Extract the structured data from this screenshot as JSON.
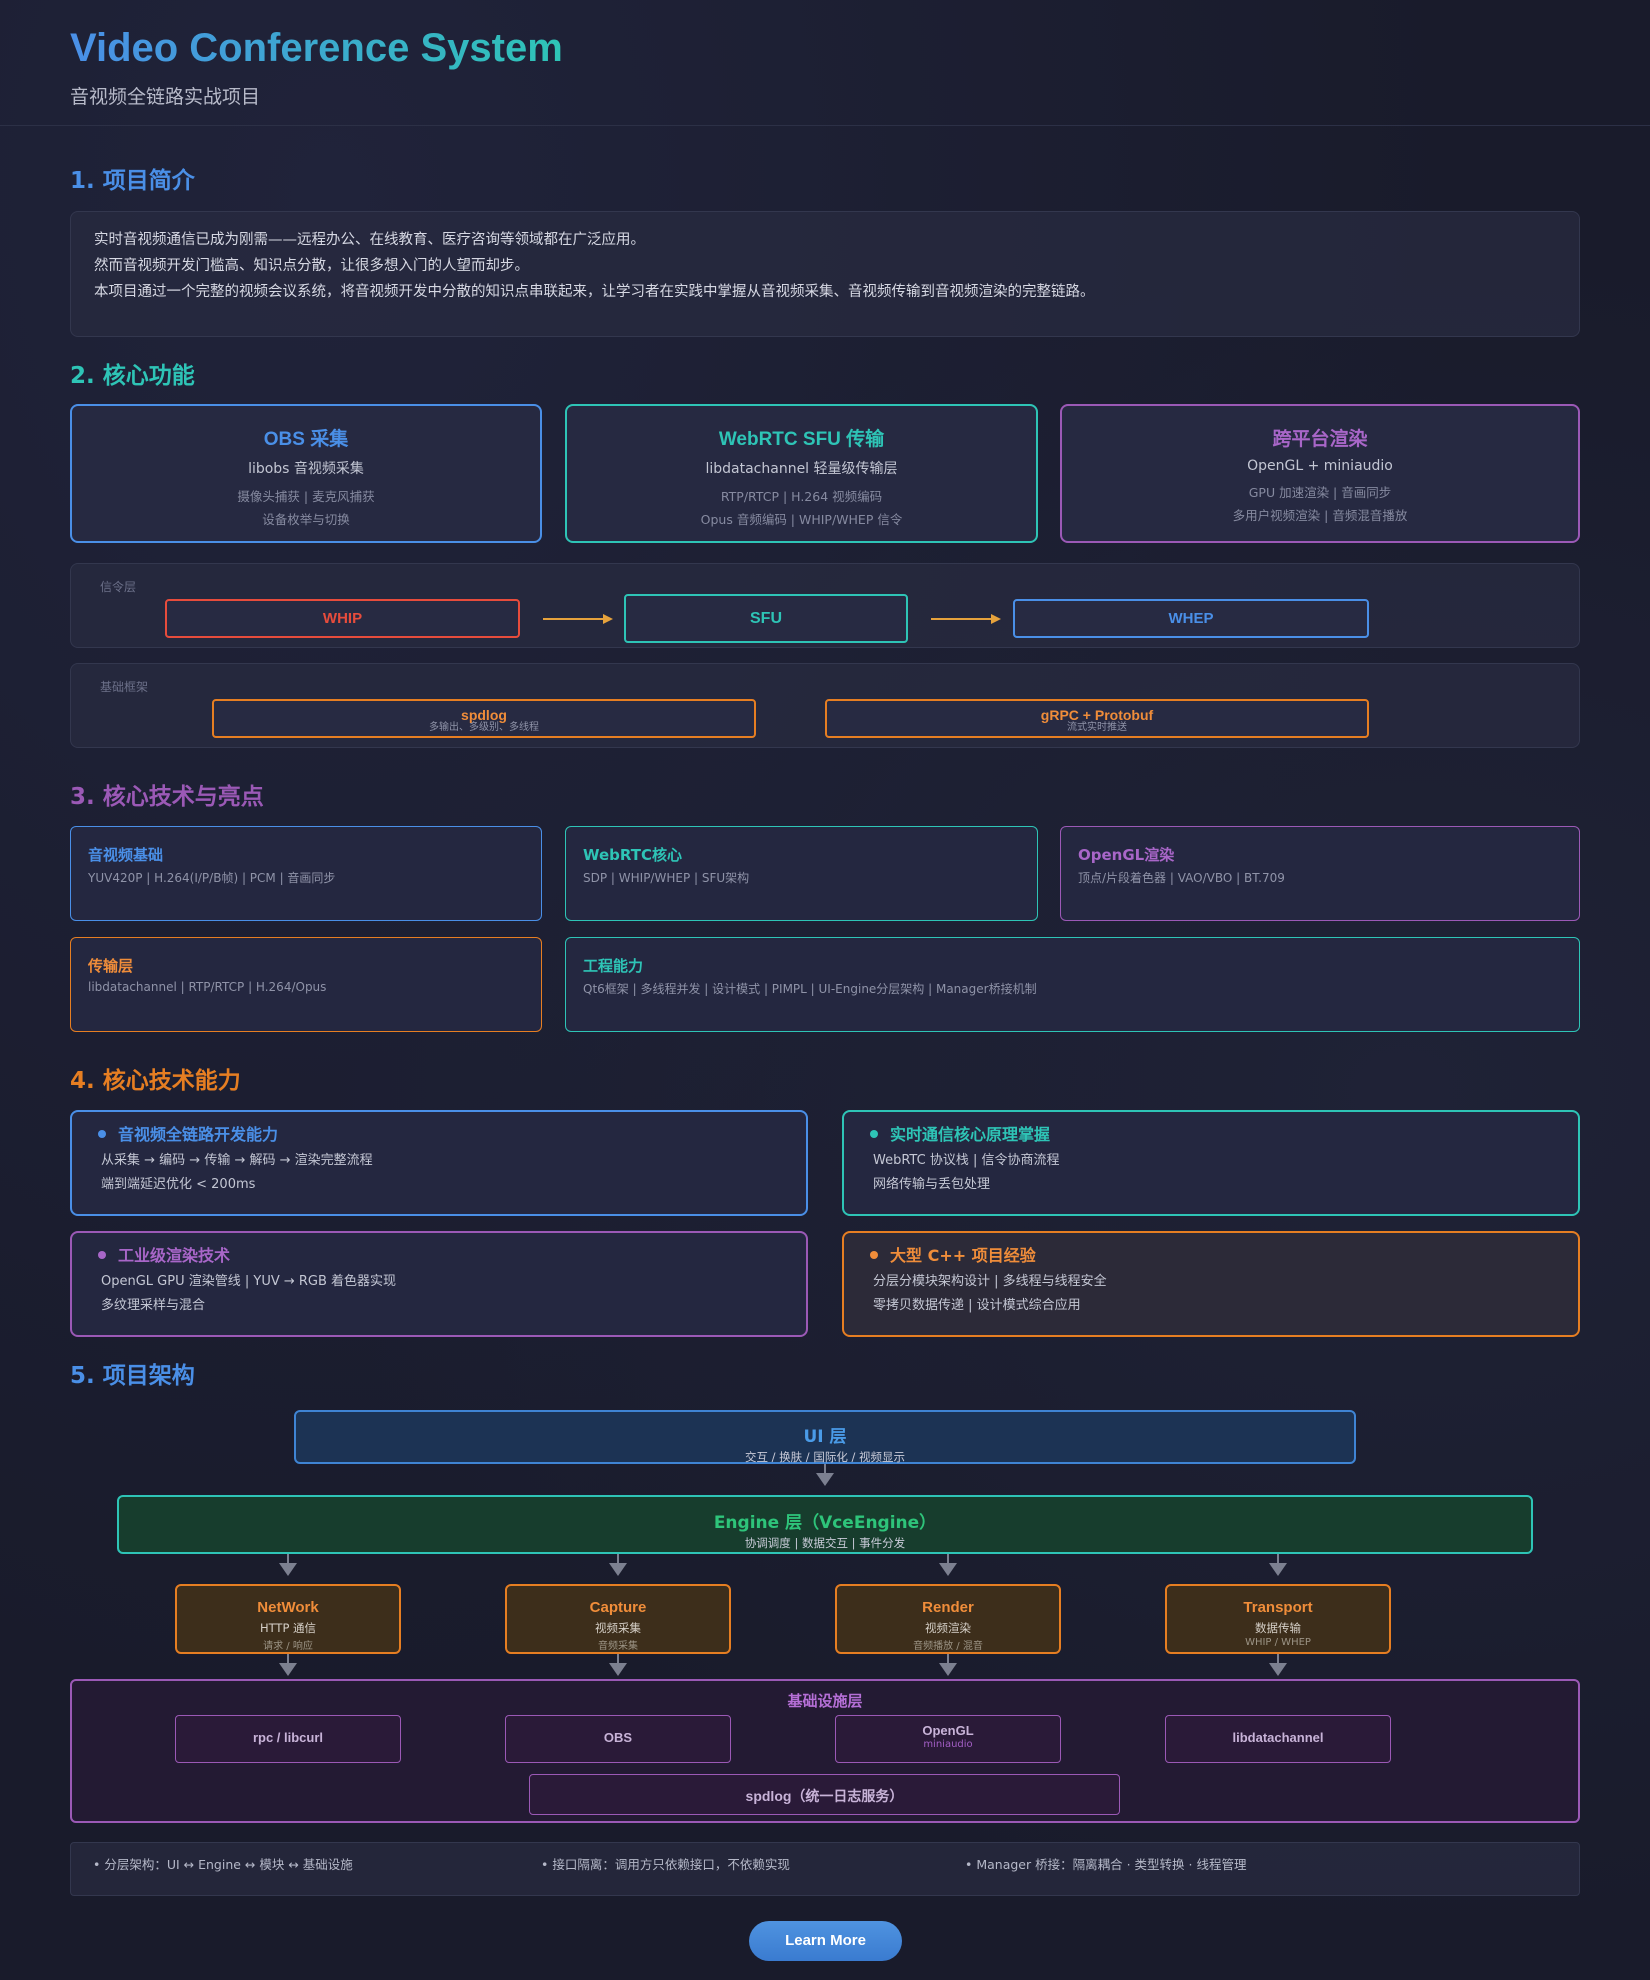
{
  "header": {
    "title": "Video Conference System",
    "subtitle": "音视频全链路实战项目"
  },
  "sections": {
    "s1": "1. 项目简介",
    "s2": "2. 核心功能",
    "s3": "3. 核心技术与亮点",
    "s4": "4. 核心技术能力",
    "s5": "5. 项目架构"
  },
  "colors": {
    "blue": "#4a8fe7",
    "teal": "#2ec4b6",
    "purple": "#9b59b6",
    "orange": "#e67e22",
    "red": "#e74c3c"
  },
  "intro": [
    "实时音视频通信已成为刚需——远程办公、在线教育、医疗咨询等领域都在广泛应用。",
    "然而音视频开发门槛高、知识点分散，让很多想入门的人望而却步。",
    "本项目通过一个完整的视频会议系统，将音视频开发中分散的知识点串联起来，让学习者在实践中掌握从音视频采集、音视频传输到音视频渲染的完整链路。"
  ],
  "features": [
    {
      "title": "OBS 采集",
      "sub": "libobs 音视频采集",
      "l1": "摄像头捕获 | 麦克风捕获",
      "l2": "设备枚举与切换"
    },
    {
      "title": "WebRTC SFU 传输",
      "sub": "libdatachannel 轻量级传输层",
      "l1": "RTP/RTCP | H.264 视频编码",
      "l2": "Opus 音频编码 | WHIP/WHEP 信令"
    },
    {
      "title": "跨平台渲染",
      "sub": "OpenGL + miniaudio",
      "l1": "GPU 加速渲染 | 音画同步",
      "l2": "多用户视频渲染 | 音频混音播放"
    }
  ],
  "signaling": {
    "label": "信令层",
    "whip": "WHIP",
    "sfu": "SFU",
    "whep": "WHEP"
  },
  "foundation": {
    "label": "基础框架",
    "spdlog": "spdlog",
    "spdlog_sub": "多输出、多级别、多线程",
    "grpc": "gRPC + Protobuf",
    "grpc_sub": "流式实时推送"
  },
  "tech": [
    {
      "title": "音视频基础",
      "desc": "YUV420P | H.264(I/P/B帧) | PCM | 音画同步"
    },
    {
      "title": "WebRTC核心",
      "desc": "SDP | WHIP/WHEP | SFU架构"
    },
    {
      "title": "OpenGL渲染",
      "desc": "顶点/片段着色器 | VAO/VBO | BT.709"
    },
    {
      "title": "传输层",
      "desc": "libdatachannel | RTP/RTCP | H.264/Opus"
    },
    {
      "title": "工程能力",
      "desc": "Qt6框架 | 多线程并发 | 设计模式 | PIMPL | UI-Engine分层架构 | Manager桥接机制"
    }
  ],
  "capabilities": [
    {
      "title": "音视频全链路开发能力",
      "l1": "从采集 → 编码 → 传输 → 解码 → 渲染完整流程",
      "l2": "端到端延迟优化 < 200ms"
    },
    {
      "title": "实时通信核心原理掌握",
      "l1": "WebRTC 协议栈 | 信令协商流程",
      "l2": "网络传输与丢包处理"
    },
    {
      "title": "工业级渲染技术",
      "l1": "OpenGL GPU 渲染管线 | YUV → RGB 着色器实现",
      "l2": "多纹理采样与混合"
    },
    {
      "title": "大型 C++ 项目经验",
      "l1": "分层分模块架构设计 | 多线程与线程安全",
      "l2": "零拷贝数据传递 | 设计模式综合应用"
    }
  ],
  "arch": {
    "ui_title": "UI 层",
    "ui_sub": "交互 / 换肤 / 国际化 / 视频显示",
    "engine_title": "Engine 层（VceEngine）",
    "engine_sub": "协调调度 | 数据交互 | 事件分发",
    "modules": [
      {
        "title": "NetWork",
        "sub": "HTTP 通信",
        "sub2": "请求 / 响应"
      },
      {
        "title": "Capture",
        "sub": "视频采集",
        "sub2": "音频采集"
      },
      {
        "title": "Render",
        "sub": "视频渲染",
        "sub2": "音频播放 / 混音"
      },
      {
        "title": "Transport",
        "sub": "数据传输",
        "sub2": "WHIP / WHEP"
      }
    ],
    "infra_title": "基础设施层",
    "infra": [
      {
        "label": "rpc / libcurl",
        "sub": ""
      },
      {
        "label": "OBS",
        "sub": ""
      },
      {
        "label": "OpenGL",
        "sub": "miniaudio"
      },
      {
        "label": "libdatachannel",
        "sub": ""
      }
    ],
    "logger": "spdlog（统一日志服务）"
  },
  "notes": [
    "• 分层架构：UI ↔ Engine ↔ 模块 ↔ 基础设施",
    "• 接口隔离：调用方只依赖接口，不依赖实现",
    "• Manager 桥接：隔离耦合 · 类型转换 · 线程管理"
  ],
  "cta": "Learn More"
}
